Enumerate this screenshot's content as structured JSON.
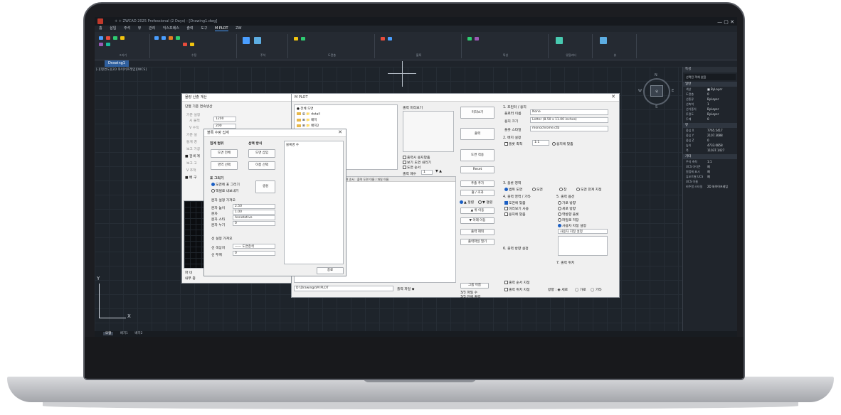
{
  "app": {
    "title": "+ + ZWCAD 2025 Professional (2 Days) - [Drawing1.dwg]",
    "window_controls": "—  ▢  ✕",
    "ribbon_tabs": [
      "홈",
      "삽입",
      "주석",
      "뷰",
      "관리",
      "익스프레스",
      "출력",
      "도구",
      "M PLOT",
      "ZW"
    ],
    "ribbon_groups": [
      "그리기",
      "수정",
      "주석",
      "도면층",
      "블록",
      "특성",
      "유틸리티",
      "뷰"
    ],
    "doc_tab": "Drawing1",
    "command_line": "[-][평면도][2D 와이어프레임][WCS]"
  },
  "viewcube": {
    "face": "위",
    "north": "N",
    "south": "S",
    "west": "W",
    "east": "E"
  },
  "statusbar": {
    "items": [
      "모형",
      "배치1",
      "배치2"
    ]
  },
  "properties": {
    "title": "특성",
    "selection": "선택된 객체 없음",
    "sections": [
      {
        "name": "일반",
        "rows": [
          [
            "색상",
            "■ ByLayer"
          ],
          [
            "도면층",
            "0"
          ],
          [
            "선종류",
            "ByLayer"
          ],
          [
            "선축척",
            "1"
          ],
          [
            "선가중치",
            "ByLayer"
          ],
          [
            "투명도",
            "ByLayer"
          ],
          [
            "두께",
            "0"
          ]
        ]
      },
      {
        "name": "뷰",
        "rows": [
          [
            "중심 X",
            "7765.5417"
          ],
          [
            "중심 Y",
            "2107.3088"
          ],
          [
            "중심 Z",
            "0"
          ],
          [
            "높이",
            "4733.0858"
          ],
          [
            "폭",
            "11037.1427"
          ]
        ]
      },
      {
        "name": "기타",
        "rows": [
          [
            "주석 축척",
            "1:1"
          ],
          [
            "UCS 아이콘",
            "예"
          ],
          [
            "원점에 표시",
            "예"
          ],
          [
            "뷰포트별 UCS",
            "예"
          ],
          [
            "UCS 이름",
            ""
          ],
          [
            "비주얼 스타일",
            "2D 와이어프레임"
          ]
        ]
      }
    ]
  },
  "bg_dialog": {
    "title": "물량 산출 계산",
    "heading": "단열 기준   면속생산",
    "labels": [
      "기준 설정",
      "시 물적",
      "V 수직",
      "기준 설",
      "통계 경",
      "보고 가공",
      "■ 검색 계",
      "보고 고",
      "V 추적",
      "■ 배 구",
      "파 비"
    ],
    "values": [
      "1200",
      "200"
    ],
    "footer": [
      "파 비",
      "내부 중"
    ]
  },
  "note_dialog": {
    "title": "블록 수량 집계",
    "sec1_title": "집계 범위",
    "sec2_title": "선택 방식",
    "btn_whole": "도면 전체",
    "btn_insert": "도면 삽입",
    "btn_area": "영역 선택",
    "btn_name": "이름 선택",
    "list_header": "블록명   수",
    "draw_title": "표 그리기",
    "radio_draw": "도면에 표 그리기",
    "radio_excel": "엑셀로 내보내기",
    "btn_create": "생성",
    "text_title": "문자 설정 가져오",
    "text_rows": [
      [
        "문자 높이",
        "2.50"
      ],
      [
        "문자",
        "1.00"
      ],
      [
        "문자 스타",
        "Annotative"
      ],
      [
        "문자 누기",
        "0"
      ]
    ],
    "line_title": "선 설정 가져오",
    "line_rows": [
      [
        "선 색상지",
        "—— 도면층색"
      ],
      [
        "선 두께",
        "0"
      ]
    ],
    "btn_close": "종료"
  },
  "plot_dialog": {
    "title": "M PLOT",
    "tree": [
      "● 전체 도면",
      "⊞ 📁 detail",
      "⊞ 📁 배치",
      "⊞ 📁 배치2"
    ],
    "preview_title": "출력 미리보기",
    "checks": [
      "출력시 용지맞춤",
      "보기 도면 내리기",
      "도면 순서",
      "출력 매수"
    ],
    "copies": "1",
    "col_headers": [
      "도면 순서",
      "출력 도면 이름 / 파일 이름"
    ],
    "btns_mid": [
      "미리보기",
      "출력",
      "도면 적용",
      "Reset"
    ],
    "btns_side": [
      "추출 추가",
      "출 / 초과",
      "▲ 위쪽",
      "▲ 위 이동",
      "▼ 아래 이동",
      "출력 제외",
      "출력파일 열기"
    ],
    "radio_sort": [
      "▲ 정렬",
      "▼ 정렬"
    ],
    "bottom_path": "D:\\Drawings\\M PLOT",
    "bottom_label": "출력 파일 ◆",
    "bottom_labels": [
      "그룹 이름",
      "3/3 파일 수",
      "3/3 전체 출력"
    ],
    "right": {
      "sec1": "1. 프린터 / 용지",
      "printer_label": "플로터 이름",
      "printer": "None",
      "paper_label": "용지 크기",
      "paper": "Letter (8.50 x 11.00 inches)",
      "style_label": "플롯 스타일",
      "style": "monochrome.ctb",
      "sec2": "2. 배치 설정",
      "scale_label": "플롯 축척",
      "scale_val": "1:1",
      "fit": "용지에 맞춤",
      "sec3": "3. 플롯 영역",
      "area": [
        "범위 도면",
        "도면",
        "창",
        "도면 한계 지정"
      ],
      "sec4": "4. 출력 영역 / 기타",
      "opts": [
        "도면에 맞춤",
        "미리보기 사용",
        "용지에 맞춤"
      ],
      "sec5": "5. 출력 옵션",
      "opts5": [
        "가로 방향",
        "세로 방향",
        "역방향 플롯",
        "파일로 저장",
        "사용자 지정 설정"
      ],
      "sec6": "6. 출력 방향 설정",
      "sec7": "7. 출력 위치",
      "dropdown": "사용자 지정 설정",
      "bottom": [
        "출력 순서 지정",
        "출력 위치 지정"
      ],
      "foot": [
        "방향 : ◉ 세로",
        "◯ 가로",
        "◯ 기타"
      ]
    }
  },
  "colors": {
    "accent": "#1b5fc4",
    "screen_bg": "#1d2229"
  }
}
